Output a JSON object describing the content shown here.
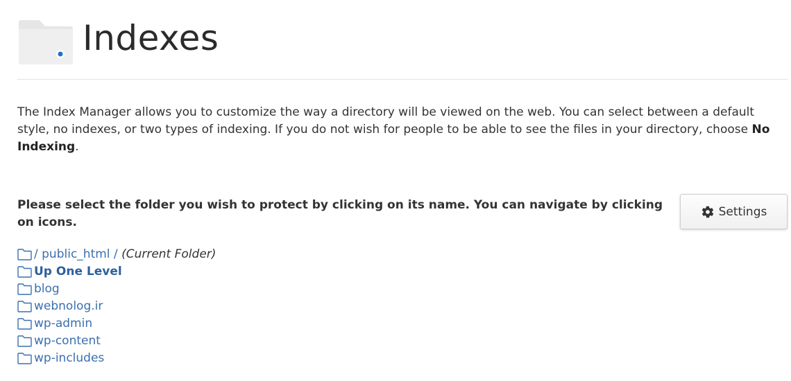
{
  "header": {
    "title": "Indexes",
    "icon": "folder-eye-icon"
  },
  "description": {
    "text": "The Index Manager allows you to customize the way a directory will be viewed on the web. You can select between a default style, no indexes, or two types of indexing. If you do not wish for people to be able to see the files in your directory, choose ",
    "bold": "No Indexing",
    "end": "."
  },
  "instruction": {
    "text": "Please select the folder you wish to protect by clicking on its name. You can navigate by clicking on icons."
  },
  "settings_button": {
    "label": "Settings",
    "icon": "gear-icon"
  },
  "current_folder": {
    "root": "/",
    "path": "public_html",
    "separator": "/",
    "note": "(Current Folder)"
  },
  "up_one_level": "Up One Level",
  "folders": [
    "blog",
    "webnolog.ir",
    "wp-admin",
    "wp-content",
    "wp-includes"
  ],
  "colors": {
    "link": "#3a6fb0",
    "text": "#333333",
    "divider": "#e3e3e3"
  }
}
